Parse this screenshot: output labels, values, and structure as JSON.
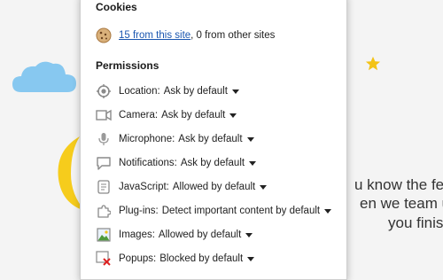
{
  "background": {
    "text_lines": [
      "u know the fe",
      "en we team u",
      "you finis"
    ],
    "colors": {
      "cloud": "#87c8f0",
      "moon": "#f6cc1c",
      "star": "#f3c316"
    }
  },
  "panel": {
    "cookies": {
      "heading": "Cookies",
      "link": "15 from this site",
      "rest": ", 0 from other sites",
      "icon": "cookie-icon"
    },
    "permissions": {
      "heading": "Permissions",
      "items": [
        {
          "label": "Location:",
          "value": "Ask by default",
          "icon": "location-icon"
        },
        {
          "label": "Camera:",
          "value": "Ask by default",
          "icon": "camera-icon"
        },
        {
          "label": "Microphone:",
          "value": "Ask by default",
          "icon": "microphone-icon"
        },
        {
          "label": "Notifications:",
          "value": "Ask by default",
          "icon": "notification-icon"
        },
        {
          "label": "JavaScript:",
          "value": "Allowed by default",
          "icon": "javascript-icon"
        },
        {
          "label": "Plug-ins:",
          "value": "Detect important content by default",
          "icon": "plugin-icon"
        },
        {
          "label": "Images:",
          "value": "Allowed by default",
          "icon": "image-icon"
        },
        {
          "label": "Popups:",
          "value": "Blocked by default",
          "icon": "popup-blocked-icon"
        }
      ]
    },
    "colors": {
      "link": "#1a56b0",
      "icon": "#8a8a8a",
      "blocked": "#d22"
    }
  }
}
